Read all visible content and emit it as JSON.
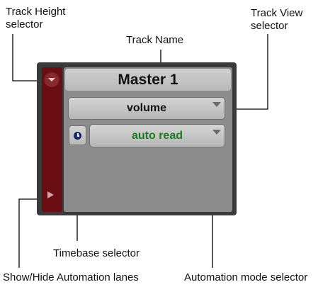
{
  "callouts": {
    "track_height": "Track Height\nselector",
    "track_view": "Track View\nselector",
    "track_name": "Track Name",
    "timebase": "Timebase selector",
    "show_hide": "Show/Hide Automation lanes",
    "automation_mode": "Automation mode selector"
  },
  "track": {
    "name": "Master 1",
    "view": "volume",
    "automation_mode": "auto read"
  },
  "colors": {
    "strip": "#6b0e14",
    "automation_text": "#1e7a22",
    "timebase_icon": "#1b2b7a"
  },
  "icons": {
    "timebase": "clock-icon",
    "track_height": "triangle-down-icon",
    "show_hide": "triangle-right-icon",
    "menu": "triangle-down-icon"
  }
}
